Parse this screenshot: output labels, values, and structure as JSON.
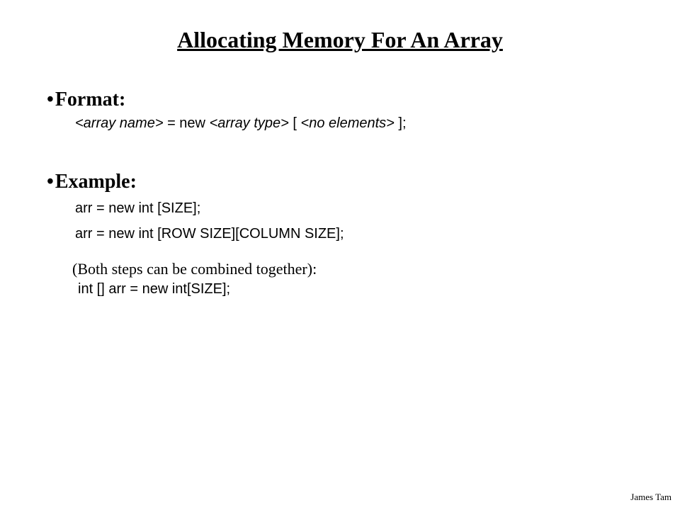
{
  "title": "Allocating Memory For An Array",
  "sections": {
    "format": {
      "heading": "Format:",
      "syntax": {
        "arrayName": "<array name>",
        "equalsNew": " = new ",
        "arrayType": "<array type>",
        "openBracket": " [ ",
        "noElements": "<no elements>",
        "closeBracket": " ];"
      }
    },
    "example": {
      "heading": "Example:",
      "lines": [
        "arr = new int [SIZE];",
        "arr = new int [ROW SIZE][COLUMN SIZE];"
      ],
      "note": "(Both steps can be combined together):",
      "combined": " int [] arr = new int[SIZE];"
    }
  },
  "footer": {
    "author": "James Tam"
  }
}
